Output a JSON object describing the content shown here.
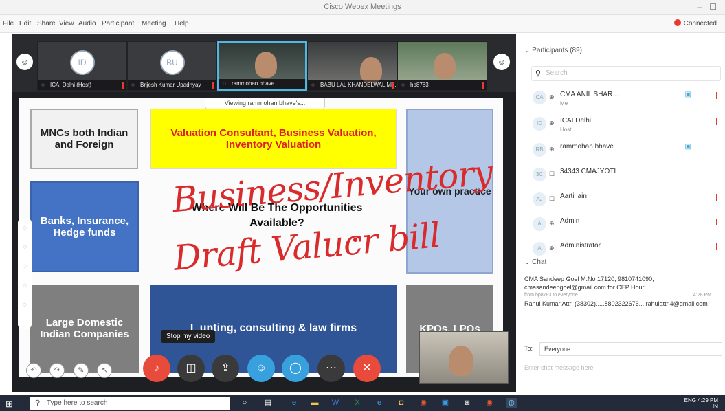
{
  "window": {
    "title": "Cisco Webex Meetings",
    "minimize": "–",
    "maximize": "☐"
  },
  "menu": {
    "items": [
      "File",
      "Edit",
      "Share",
      "View",
      "Audio",
      "Participant",
      "Meeting",
      "Help"
    ],
    "status": "Connected"
  },
  "thumbnails": [
    {
      "initials": "ID",
      "name": "ICAI Delhi (Host)"
    },
    {
      "initials": "BU",
      "name": "Brijesh Kumar Upadhyay"
    },
    {
      "name": "rammohan bhave"
    },
    {
      "name": "BABU LAL KHANDELWAL ME..."
    },
    {
      "name": "hp8783"
    }
  ],
  "slide": {
    "viewing_label": "Viewing rammohan bhave's...",
    "boxes": {
      "mncs": "MNCs both Indian and Foreign",
      "valuation": "Valuation Consultant, Business Valuation, Inventory Valuation",
      "own_practice": "Your own practice",
      "banks": "Banks, Insurance, Hedge funds",
      "domestic": "Large Domestic Indian Companies",
      "accounting": "L        unting, consulting & law firms",
      "kpos": "KPOs, LPOs"
    },
    "question": "Where Will Be The Opportunities Available?",
    "ink_line1": "Business/Inventory",
    "ink_line2": "Draft Valucr bill"
  },
  "controls": {
    "tooltip": "Stop my video"
  },
  "participants": {
    "header": "Participants (89)",
    "search_placeholder": "Search",
    "list": [
      {
        "initials": "CA",
        "name": "CMA ANIL SHAR...",
        "role": "Me"
      },
      {
        "initials": "ID",
        "name": "ICAI Delhi",
        "role": "Host"
      },
      {
        "initials": "RB",
        "name": "rammohan bhave",
        "role": ""
      },
      {
        "initials": "3C",
        "name": "34343 CMAJYOTI",
        "role": ""
      },
      {
        "initials": "AJ",
        "name": "Aarti jain",
        "role": ""
      },
      {
        "initials": "A",
        "name": "Admin",
        "role": ""
      },
      {
        "initials": "A",
        "name": "Administrator",
        "role": ""
      }
    ]
  },
  "chat": {
    "header": "Chat",
    "messages": [
      {
        "text": "CMA Sandeep Goel M.No 17120, 9810741090, cmasandeepgoel@gmail.com for CEP Hour",
        "meta": "from hp8783 to everyone",
        "time": "4:28 PM"
      },
      {
        "text": "Rahul Kumar Attri (38302).....8802322676....rahulattri4@gmail.com",
        "meta": "",
        "time": ""
      }
    ],
    "to_label": "To:",
    "to_value": "Everyone",
    "input_placeholder": "Enter chat message here"
  },
  "taskbar": {
    "search_placeholder": "Type here to search",
    "lang": "ENG",
    "time": "4:29 PM",
    "date": "IN"
  }
}
